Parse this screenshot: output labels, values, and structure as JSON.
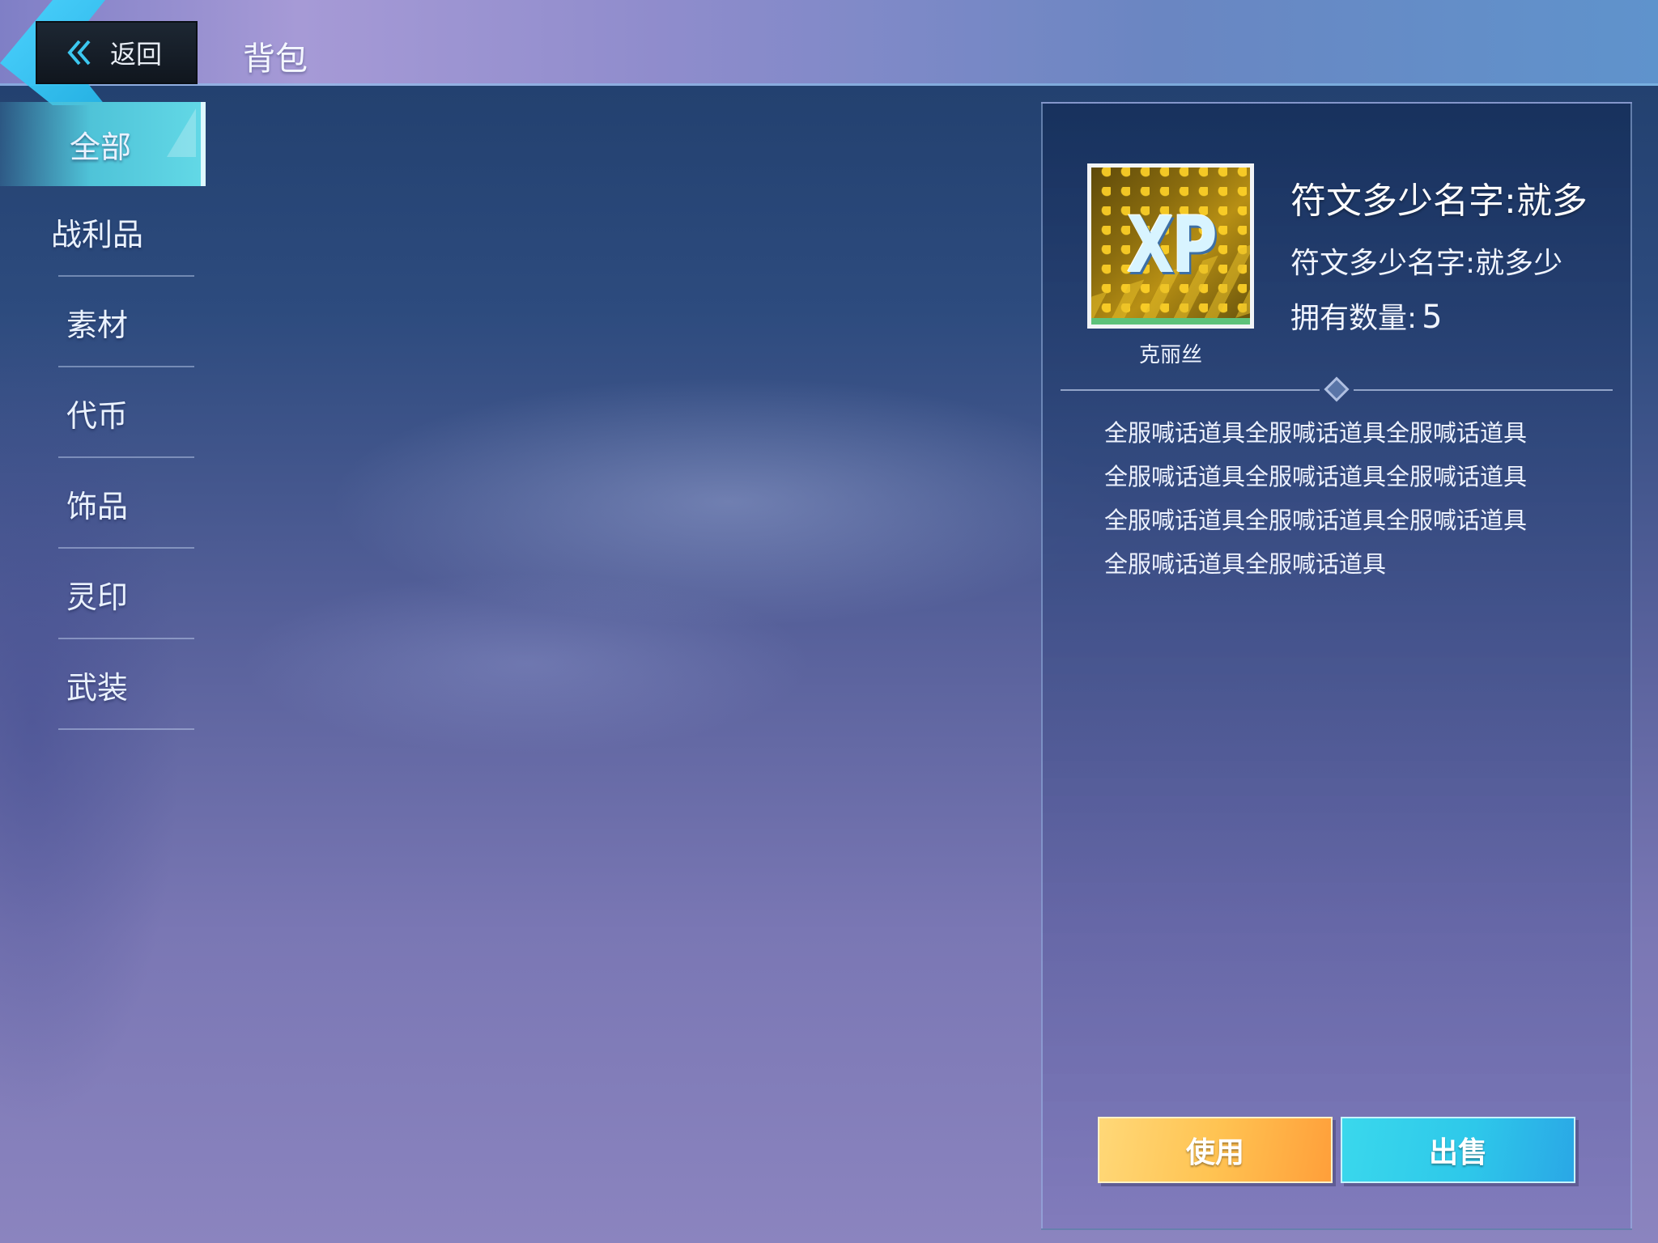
{
  "header": {
    "back_label": "返回",
    "title": "背包"
  },
  "sidebar": {
    "tabs": [
      {
        "label": "全部",
        "active": true
      },
      {
        "label": "战利品",
        "active": false
      },
      {
        "label": "素材",
        "active": false
      },
      {
        "label": "代币",
        "active": false
      },
      {
        "label": "饰品",
        "active": false
      },
      {
        "label": "灵印",
        "active": false
      },
      {
        "label": "武装",
        "active": false
      }
    ]
  },
  "detail": {
    "icon_text": "XP",
    "owner": "克丽丝",
    "name": "符文多少名字:就多",
    "subtitle": "符文多少名字:就多少",
    "count_label": "拥有数量:",
    "count_value": "5",
    "description_lines": [
      "全服喊话道具全服喊话道具全服喊话道具",
      "全服喊话道具全服喊话道具全服喊话道具",
      "全服喊话道具全服喊话道具全服喊话道具",
      "全服喊话道具全服喊话道具"
    ],
    "use_label": "使用",
    "sell_label": "出售"
  },
  "colors": {
    "accent_cyan": "#2ec8ea",
    "use_orange": "#ffb24a",
    "rarity_green": "#5ec27a"
  },
  "icons": {
    "back": "double-chevron-left-icon"
  }
}
